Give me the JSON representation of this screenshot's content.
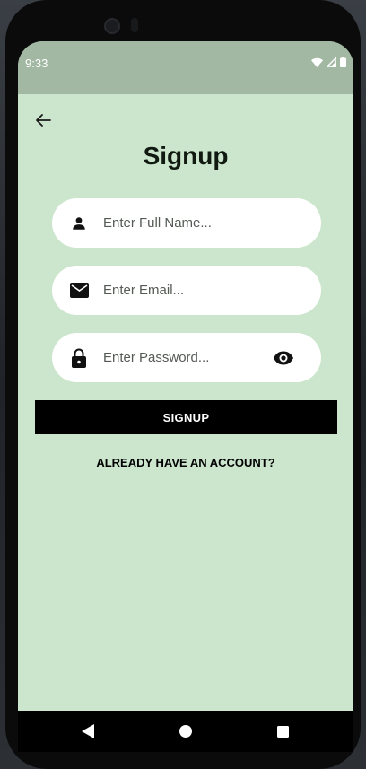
{
  "status_bar": {
    "time": "9:33",
    "icons": [
      "wifi-icon",
      "cellular-signal-icon",
      "battery-icon"
    ]
  },
  "header": {
    "back_icon": "arrow-left-icon",
    "title": "Signup"
  },
  "form": {
    "full_name": {
      "icon": "person-icon",
      "placeholder": "Enter Full Name...",
      "value": ""
    },
    "email": {
      "icon": "mail-icon",
      "placeholder": "Enter Email...",
      "value": ""
    },
    "password": {
      "icon": "lock-icon",
      "placeholder": "Enter Password...",
      "value": "",
      "toggle_icon": "eye-icon"
    },
    "submit_label": "SIGNUP",
    "login_link_label": "ALREADY HAVE AN ACCOUNT?"
  },
  "nav_bar": {
    "buttons": [
      "back-triangle-icon",
      "home-circle-icon",
      "recents-square-icon"
    ]
  },
  "colors": {
    "screen_background": "#cbe6cc",
    "status_bar_background": "#a2b8a2",
    "field_background": "#ffffff",
    "button_background": "#000000",
    "button_text": "#ffffff"
  }
}
